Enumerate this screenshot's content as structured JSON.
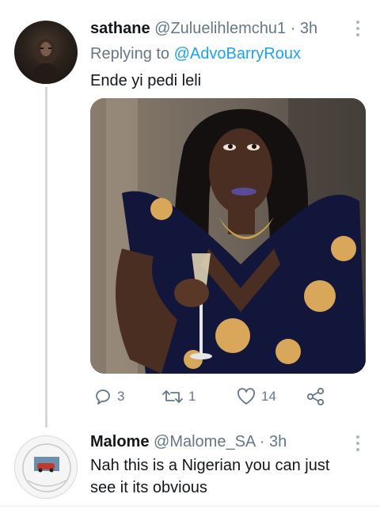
{
  "tweets": [
    {
      "author_name": "sathane",
      "handle": "@Zuluelihlemchu1",
      "separator": "·",
      "time": "3h",
      "replying_prefix": "Replying to",
      "replying_to": "@AdvoBarryRoux",
      "text": "Ende yi pedi leli",
      "media": "photo-woman-holding-champagne-glass",
      "actions": {
        "reply_count": "3",
        "retweet_count": "1",
        "like_count": "14"
      }
    },
    {
      "author_name": "Malome",
      "handle": "@Malome_SA",
      "separator": "·",
      "time": "3h",
      "text": "Nah this is a Nigerian you can just see it its obvious"
    }
  ],
  "icons": {
    "more": "more-vertical-icon",
    "reply": "reply-icon",
    "retweet": "retweet-icon",
    "like": "heart-icon",
    "share": "share-icon"
  },
  "colors": {
    "accent": "#1da1f2",
    "text_primary": "#14171a",
    "text_secondary": "#657786",
    "thread_line": "#cfd9de"
  }
}
